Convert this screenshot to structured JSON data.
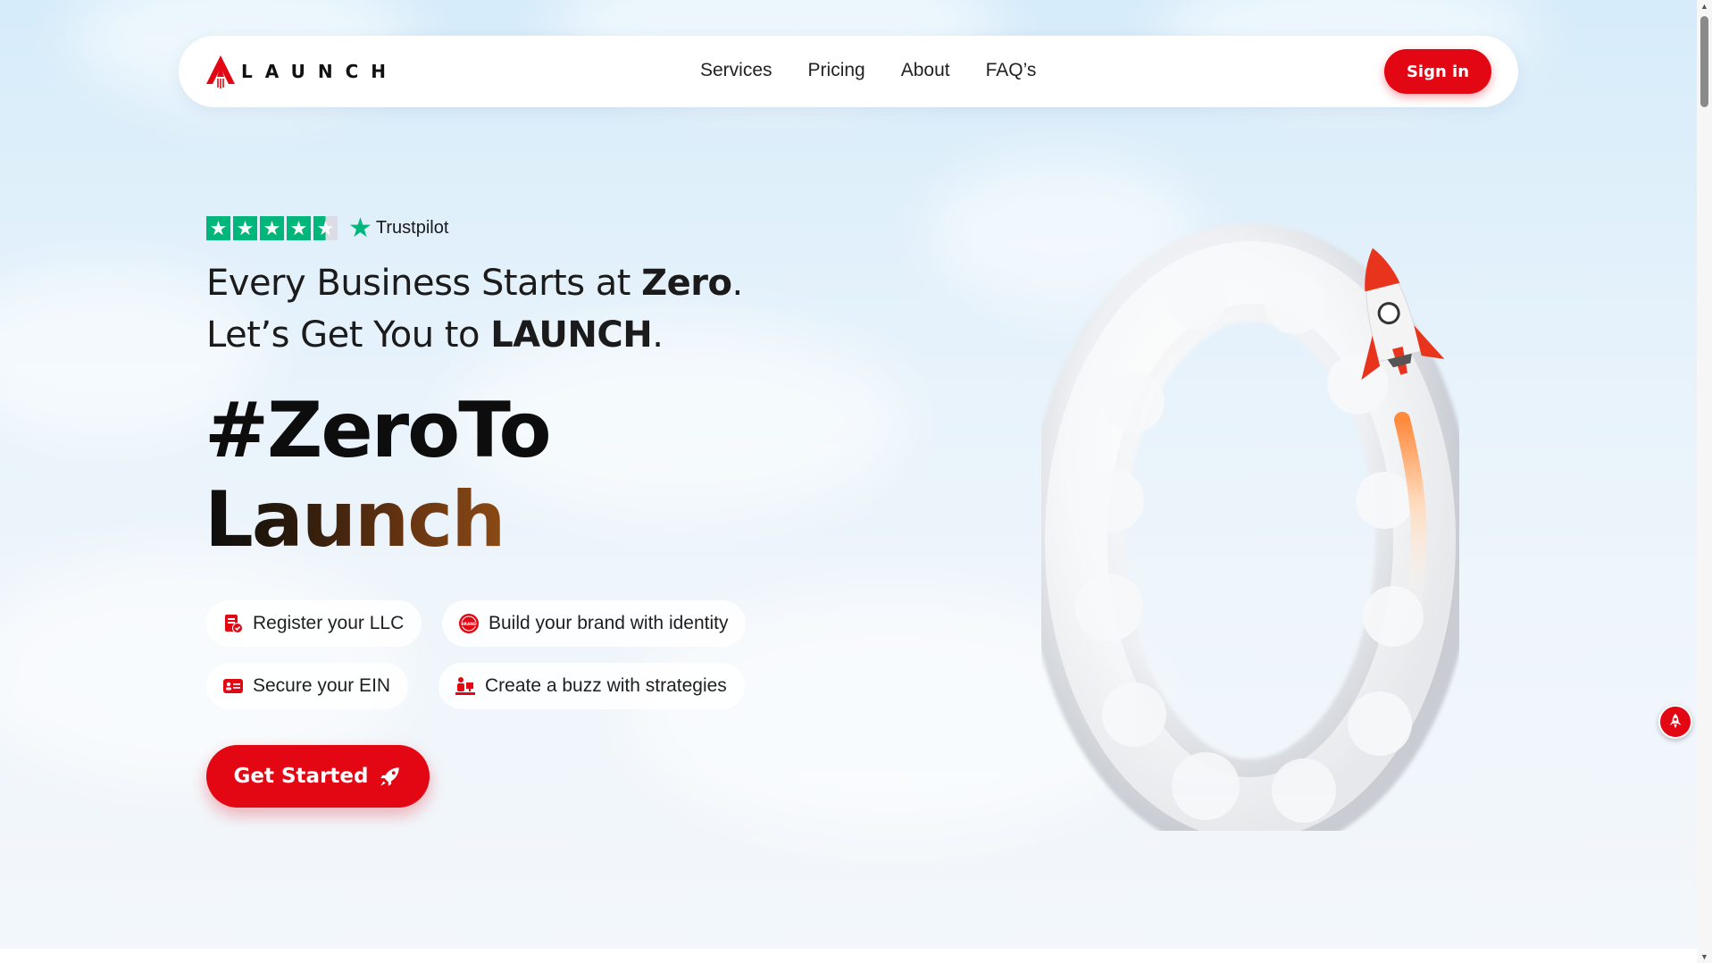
{
  "brand": {
    "name": "LAUNCH",
    "accent_color": "#e30613"
  },
  "nav": {
    "links": [
      "Services",
      "Pricing",
      "About",
      "FAQ’s"
    ],
    "signin_label": "Sign in"
  },
  "hero": {
    "trustpilot": {
      "label": "Trustpilot",
      "rating_stars": 4.5,
      "star_color": "#00b67a"
    },
    "tagline": {
      "line1_prefix": "Every Business Starts at ",
      "line1_bold": "Zero",
      "line1_suffix": ".",
      "line2_prefix": "Let’s Get You to ",
      "line2_bold": "LAUNCH",
      "line2_suffix": "."
    },
    "headline": {
      "line1": "#ZeroTo",
      "line2": "Launch"
    },
    "features": [
      {
        "label": "Register your LLC",
        "icon": "document-check-icon"
      },
      {
        "label": "Build your brand with identity",
        "icon": "brand-badge-icon"
      },
      {
        "label": "Secure your EIN",
        "icon": "id-card-icon"
      },
      {
        "label": "Create a buzz with strategies",
        "icon": "strategy-icon"
      }
    ],
    "cta_label": "Get Started",
    "cta_icon": "rocket-icon",
    "art": {
      "icon": "cloud-zero-rocket-illustration"
    }
  },
  "floating_button": {
    "icon": "rocket-icon"
  }
}
